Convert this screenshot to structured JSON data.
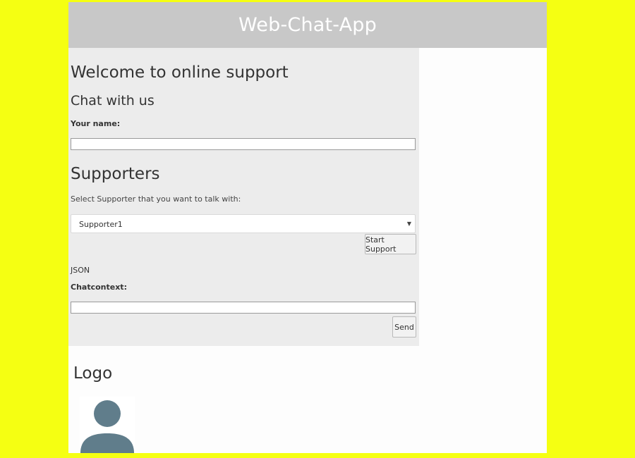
{
  "header": {
    "title": "Web-Chat-App"
  },
  "support": {
    "welcome_heading": "Welcome to online support",
    "chat_heading": "Chat with us",
    "name_label": "Your name:",
    "name_value": "",
    "supporters_heading": "Supporters",
    "select_prompt": "Select Supporter that you want to talk with:",
    "selected_supporter": "Supporter1",
    "start_button": "Start Support",
    "json_label": "JSON",
    "chatcontext_label": "Chatcontext:",
    "chatcontext_value": "",
    "send_button": "Send"
  },
  "logo": {
    "heading": "Logo",
    "icon": "user-avatar-icon"
  },
  "colors": {
    "page_background": "#f5ff12",
    "header_background": "#c8c8c8",
    "panel_background": "#ececec",
    "avatar_fill": "#607d8b"
  }
}
